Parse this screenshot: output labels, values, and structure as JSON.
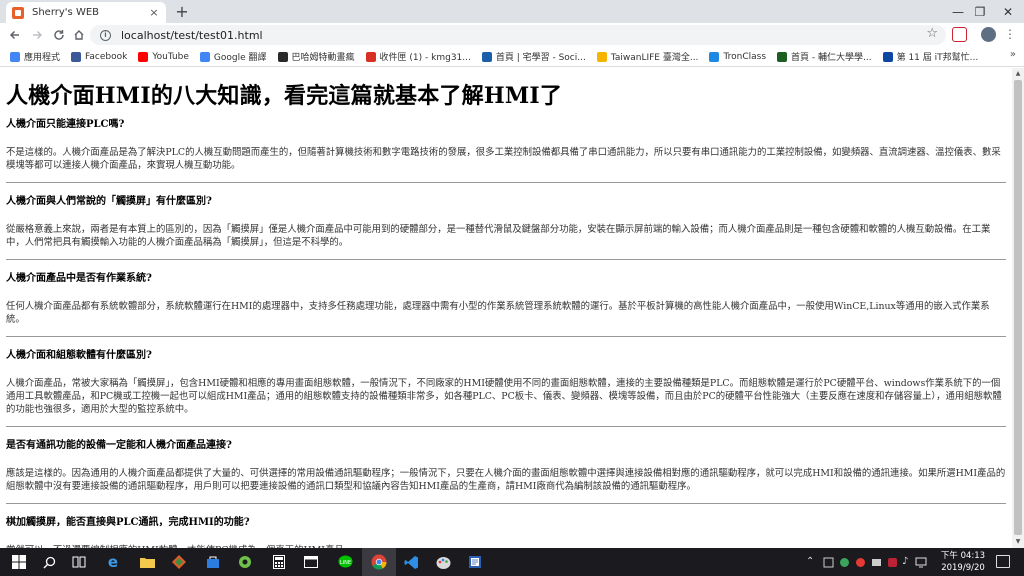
{
  "browser": {
    "tab_title": "Sherry's WEB",
    "tab_close": "×",
    "new_tab": "+",
    "url": "localhost/test/test01.html",
    "window_controls": [
      "—",
      "❐",
      "✕"
    ],
    "more_bookmarks": "»"
  },
  "bookmarks": [
    {
      "label": "應用程式",
      "icon": "apps-grid-icon",
      "color": "#4285f4"
    },
    {
      "label": "Facebook",
      "icon": "facebook-icon",
      "color": "#3b5998"
    },
    {
      "label": "YouTube",
      "icon": "youtube-icon",
      "color": "#ff0000"
    },
    {
      "label": "Google 翻譯",
      "icon": "google-translate-icon",
      "color": "#4285f4"
    },
    {
      "label": "巴哈姆特動畫瘋",
      "icon": "bahamut-icon",
      "color": "#2a2a2a"
    },
    {
      "label": "收件匣 (1) - kmg31...",
      "icon": "gmail-icon",
      "color": "#d93025"
    },
    {
      "label": "首頁 | 宅學習 - Soci...",
      "icon": "elearning-icon",
      "color": "#1a5fa8"
    },
    {
      "label": "TaiwanLIFE 臺灣全...",
      "icon": "taiwanlife-icon",
      "color": "#f5b400"
    },
    {
      "label": "TronClass",
      "icon": "tronclass-icon",
      "color": "#1e88e5"
    },
    {
      "label": "首頁 - 輔仁大學學...",
      "icon": "fju-icon",
      "color": "#1b5e20"
    },
    {
      "label": "第 11 屆 iT邦幫忙...",
      "icon": "ithome-icon",
      "color": "#0d47a1"
    }
  ],
  "page": {
    "title": "人機介面HMI的八大知識，看完這篇就基本了解HMI了",
    "sections": [
      {
        "question": "人機介面只能連接PLC嗎?",
        "answer": "不是這樣的。人機介面產品是為了解決PLC的人機互動問題而產生的，但隨著計算機技術和數字電路技術的發展，很多工業控制設備都具備了串口通訊能力，所以只要有串口通訊能力的工業控制設備，如變頻器、直流調速器、溫控儀表、數采模塊等都可以連接人機介面產品，來實現人機互動功能。"
      },
      {
        "question": "人機介面與人們常說的「觸摸屏」有什麼區別?",
        "answer": "從嚴格意義上來說，兩者是有本質上的區別的，因為「觸摸屏」僅是人機介面產品中可能用到的硬體部分，是一種替代滑鼠及鍵盤部分功能，安裝在顯示屏前端的輸入設備；而人機介面產品則是一種包含硬體和軟體的人機互動設備。在工業中，人們常把具有觸摸輸入功能的人機介面產品稱為「觸摸屏」，但這是不科學的。"
      },
      {
        "question": "人機介面產品中是否有作業系統?",
        "answer": "任何人機介面產品都有系統軟體部分，系統軟體運行在HMI的處理器中，支持多任務處理功能，處理器中需有小型的作業系統管理系統軟體的運行。基於平板計算機的高性能人機介面產品中，一般使用WinCE,Linux等通用的嵌入式作業系統。"
      },
      {
        "question": "人機介面和組態軟體有什麼區別?",
        "answer": "人機介面產品，常被大家稱為「觸摸屏」，包含HMI硬體和相應的專用畫面組態軟體，一般情況下，不同廠家的HMI硬體使用不同的畫面組態軟體，連接的主要設備種類是PLC。而組態軟體是運行於PC硬體平台、windows作業系統下的一個通用工具軟體產品，和PC機或工控機一起也可以組成HMI產品；通用的組態軟體支持的設備種類非常多，如各種PLC、PC板卡、儀表、變頻器、模塊等設備，而且由於PC的硬體平台性能強大（主要反應在速度和存儲容量上），通用組態軟體的功能也強很多，適用於大型的監控系統中。"
      },
      {
        "question": "是否有通訊功能的設備一定能和人機介面產品連接?",
        "answer": "應該是這樣的。因為通用的人機介面產品都提供了大量的、可供選擇的常用設備通訊驅動程序；一般情況下，只要在人機介面的畫面組態軟體中選擇與連接設備相對應的通訊驅動程序，就可以完成HMI和設備的通訊連接。如果所選HMI產品的組態軟體中沒有要連接設備的通訊驅動程序，用戶則可以把要連接設備的通訊口類型和協議內容告知HMI產品的生產商，請HMI廠商代為編制該設備的通訊驅動程序。"
      },
      {
        "question": "棋加觸摸屏，能否直接與PLC通訊，完成HMI的功能?",
        "answer": "當然可以。不過還要編制相應的HMI軟體，才能使PC機成為一個真正的HMI產品。"
      }
    ]
  },
  "taskbar": {
    "clock_time": "下午 04:13",
    "clock_date": "2019/9/20",
    "tray_glyphs": [
      "⌃",
      "♪"
    ]
  }
}
